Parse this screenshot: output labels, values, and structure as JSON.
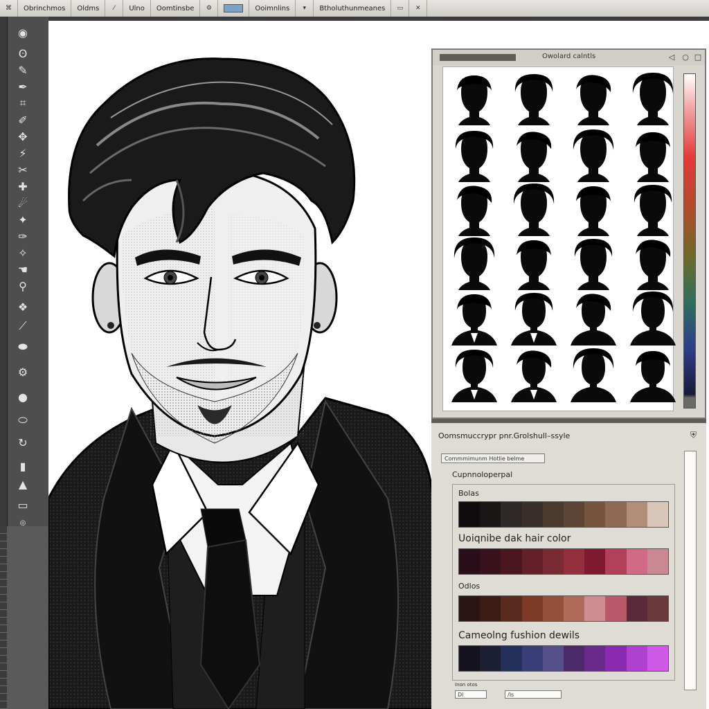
{
  "menubar": {
    "items": [
      "Obrinchmos",
      "Oldms",
      "Ulno",
      "Oomtinsbe"
    ],
    "search_label": "Ooimnlins",
    "right_label": "Btholuthunmeanes"
  },
  "style_panel": {
    "title": "Owolard calntls"
  },
  "color_panel": {
    "header": "Oomsmuccrypr pnr.Grolshull–ssyle",
    "field_value": "Commmimunm Hotlie belme",
    "section_title": "Cupnnoloperpal",
    "rows": [
      {
        "label": "Bolas",
        "colors": [
          "#0e0c0c",
          "#1a1616",
          "#2e2826",
          "#3a2f2a",
          "#4a3a2e",
          "#5e4434",
          "#76553f",
          "#8e6a55",
          "#b08e78",
          "#d8c6b8"
        ]
      },
      {
        "label": "Uoiqnibe dak hair color",
        "colors": [
          "#2a0f1a",
          "#3a121e",
          "#4c1620",
          "#642028",
          "#7a2a32",
          "#94303e",
          "#7e1a30",
          "#b3405a",
          "#d06a86",
          "#c98892"
        ]
      },
      {
        "label": "Odlos",
        "colors": [
          "#2a1414",
          "#3e1c16",
          "#5a2a1e",
          "#7a3a26",
          "#945038",
          "#b06a5a",
          "#cc8e8e",
          "#b85a6a",
          "#5a2a3a",
          "#6a3a3a"
        ]
      },
      {
        "label": "Cameolng fushion dewils",
        "colors": [
          "#14121e",
          "#1c1e34",
          "#22305a",
          "#3a3e78",
          "#544e8a",
          "#4a2a6a",
          "#6a2a8a",
          "#8a2ab0",
          "#b040d0",
          "#d05ae8"
        ]
      }
    ],
    "foot_label": "Inon otos",
    "foot_input_1": "Dl",
    "foot_input_2": "/Is"
  },
  "colors": {
    "toolbar_bg": "#4e4e4e",
    "panel_bg": "#d8d6cf",
    "canvas_bg": "#ffffff"
  }
}
